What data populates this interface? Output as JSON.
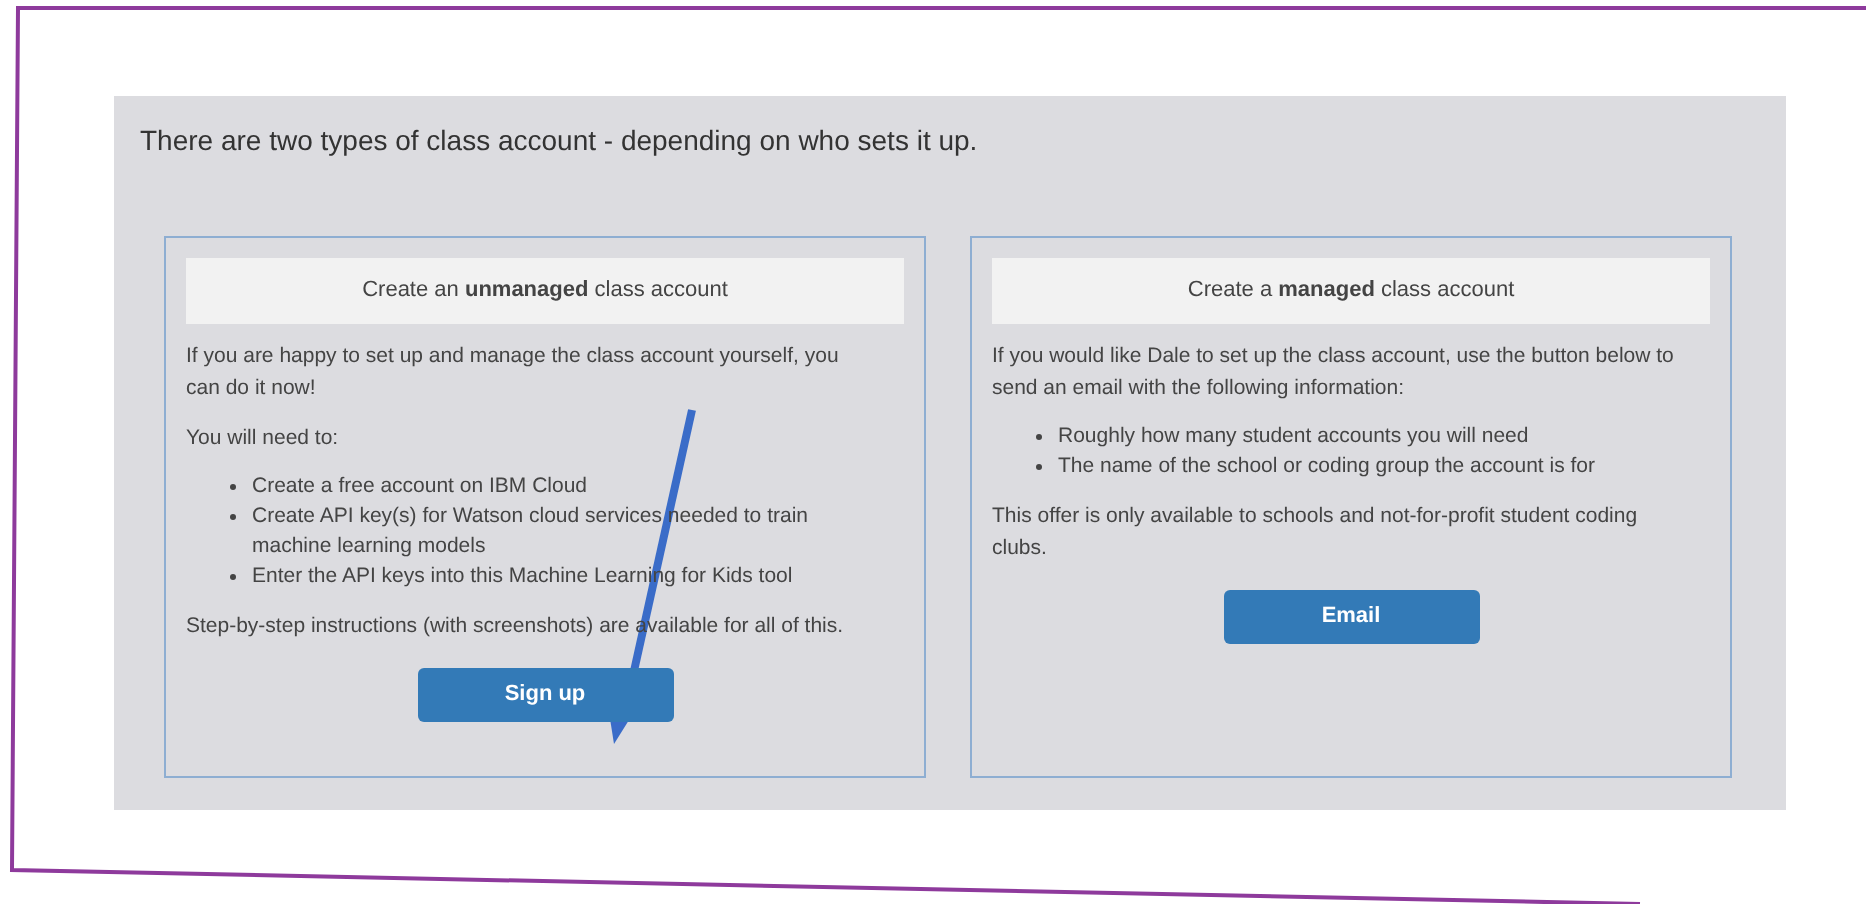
{
  "intro": "There are two types of class account - depending on who sets it up.",
  "cards": [
    {
      "title": "Create an **unmanaged** class account",
      "blocks": [
        {
          "kind": "text",
          "text": "If you are happy to set up and manage the class account yourself, you can do it now!"
        },
        {
          "kind": "text",
          "text": "You will need to:"
        },
        {
          "kind": "list",
          "items": [
            "Create a free account on IBM Cloud",
            "Create API key(s) for Watson cloud services needed to train machine learning models",
            "Enter the API keys into this Machine Learning for Kids tool"
          ]
        },
        {
          "kind": "text",
          "text": "Step-by-step instructions (with screenshots) are available for all of this."
        }
      ],
      "button": "Sign up"
    },
    {
      "title": "Create a **managed** class account",
      "blocks": [
        {
          "kind": "text",
          "text": "If you would like Dale to set up the class account, use the button below to send an email with the following information:"
        },
        {
          "kind": "list",
          "items": [
            "Roughly how many student accounts you will need",
            "The name of the school or coding group the account is for"
          ]
        },
        {
          "kind": "text",
          "text": "This offer is only available to schools and not-for-profit student coding clubs."
        }
      ],
      "button": "Email"
    }
  ]
}
